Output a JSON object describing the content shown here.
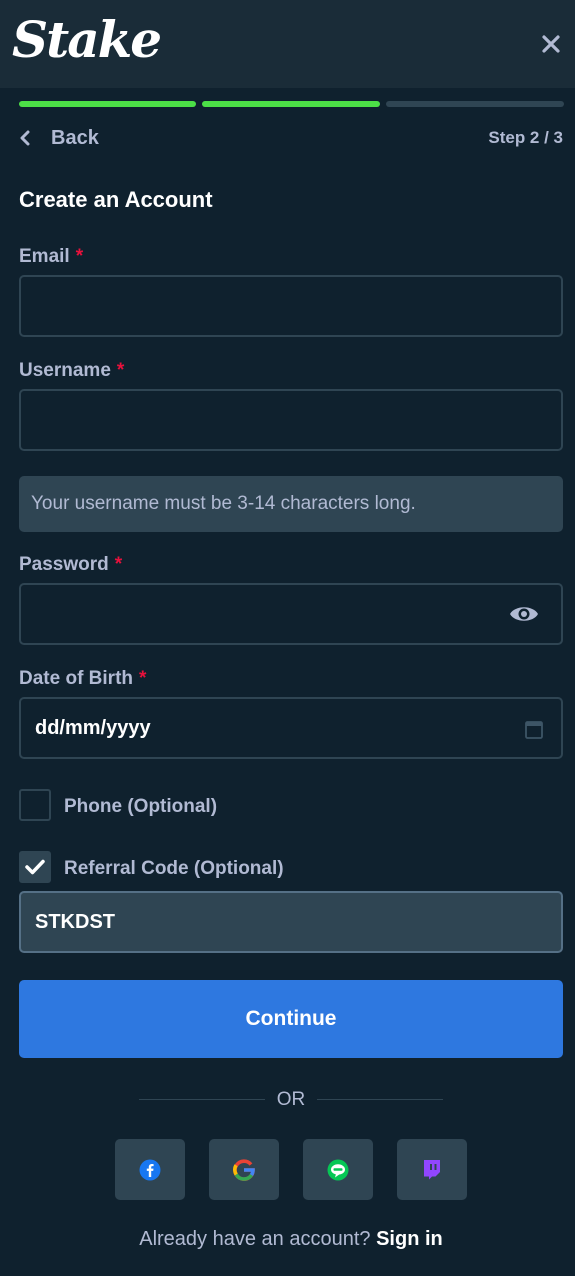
{
  "brand": {
    "logo_text": "Stake"
  },
  "header": {
    "close_icon": "close-icon"
  },
  "progress": {
    "current_step": 2,
    "total_steps": 3,
    "active_color": "#4ce047",
    "inactive_color": "#2f4553"
  },
  "nav": {
    "back_label": "Back",
    "step_text": "Step 2 / 3"
  },
  "form": {
    "title": "Create an Account",
    "required_marker": "*",
    "email": {
      "label": "Email",
      "value": ""
    },
    "username": {
      "label": "Username",
      "value": "",
      "hint": "Your username must be 3-14 characters long."
    },
    "password": {
      "label": "Password",
      "value": "",
      "toggle_icon": "eye-icon"
    },
    "dob": {
      "label": "Date of Birth",
      "value": "dd/mm/yyyy",
      "icon": "calendar-icon"
    },
    "phone": {
      "label": "Phone (Optional)",
      "checked": false
    },
    "referral": {
      "label": "Referral Code (Optional)",
      "checked": true,
      "value": "STKDST"
    },
    "continue_label": "Continue"
  },
  "divider": {
    "text": "OR"
  },
  "social": [
    {
      "name": "facebook-icon"
    },
    {
      "name": "google-icon"
    },
    {
      "name": "line-icon"
    },
    {
      "name": "twitch-icon"
    }
  ],
  "footer": {
    "prompt": "Already have an account?",
    "signin_label": "Sign in"
  },
  "colors": {
    "accent": "#2e78e0",
    "required": "#e9113c",
    "background": "#0f212e",
    "header": "#1a2c38"
  }
}
